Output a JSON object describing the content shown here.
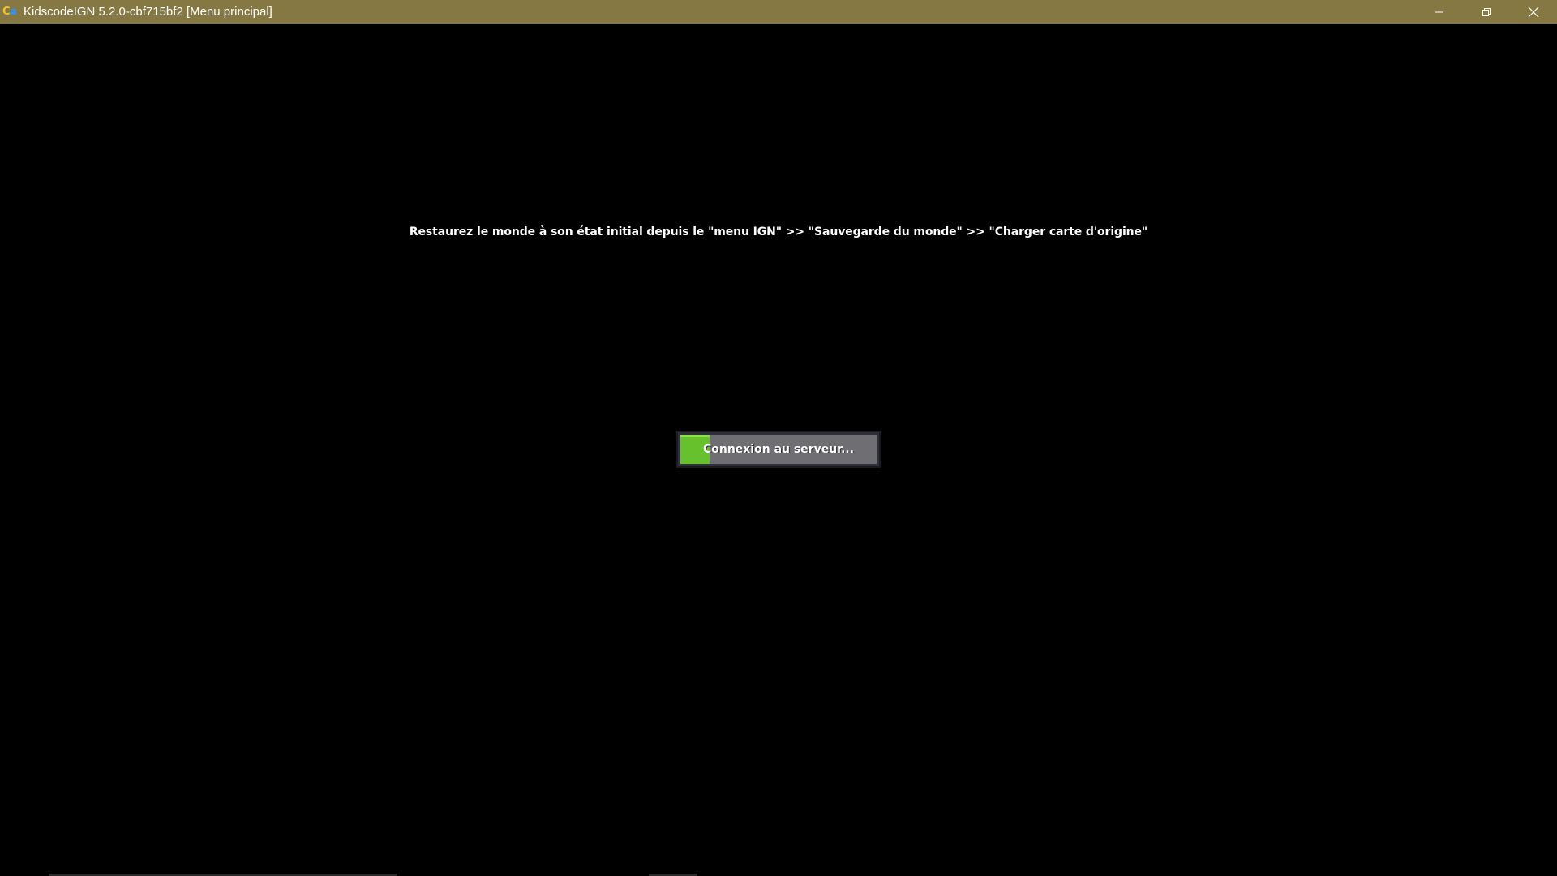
{
  "window": {
    "title": "KidscodeIGN 5.2.0-cbf715bf2 [Menu principal]",
    "titlebar_color": "#857842",
    "app_icon": "kidscode-app-icon",
    "controls": {
      "minimize_icon": "minimize-icon",
      "restore_icon": "restore-icon",
      "close_icon": "close-icon"
    }
  },
  "main": {
    "hint": "Restaurez le monde à son état initial depuis le \"menu IGN\" >> \"Sauvegarde du monde\" >> \"Charger carte d'origine\"",
    "progress": {
      "label": "Connexion au serveur...",
      "value": 0.15,
      "fill_color": "#67c12c"
    }
  }
}
